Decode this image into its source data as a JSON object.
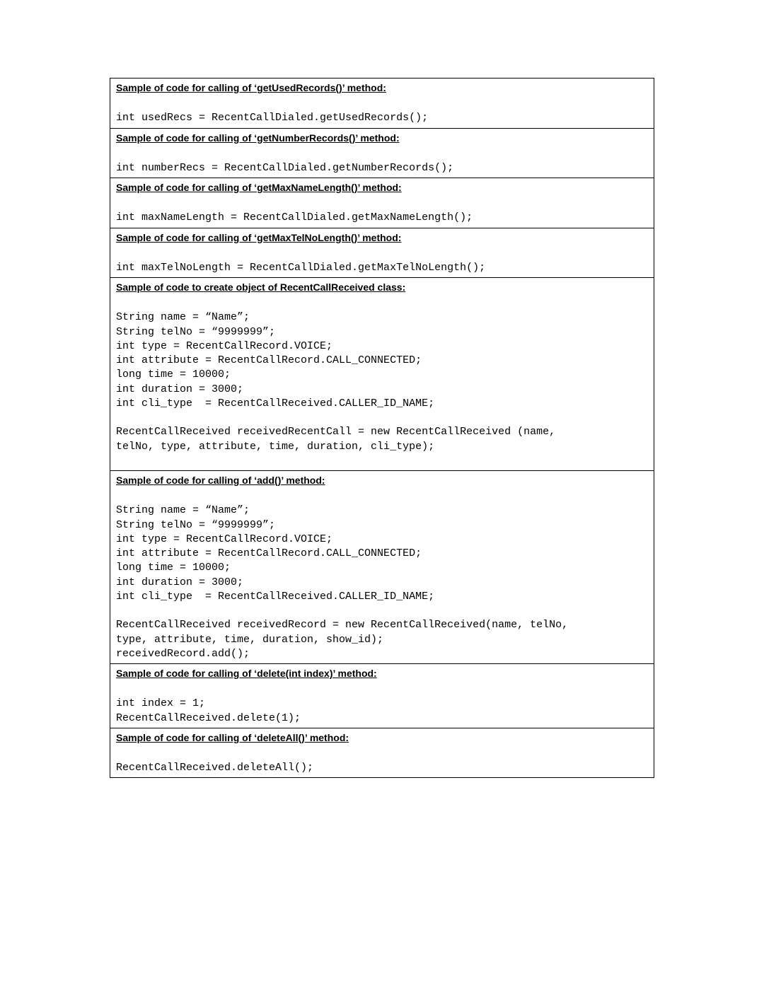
{
  "sections": [
    {
      "heading": "Sample of code for calling of ‘getUsedRecords()’ method:",
      "code": "\nint usedRecs = RecentCallDialed.getUsedRecords();\n"
    },
    {
      "heading": "Sample of code for calling of ‘getNumberRecords()’ method:",
      "code": "\nint numberRecs = RecentCallDialed.getNumberRecords();"
    },
    {
      "heading": "Sample of code for calling of ‘getMaxNameLength()’ method:",
      "code": "\nint maxNameLength = RecentCallDialed.getMaxNameLength();\n"
    },
    {
      "heading": "Sample of code for calling of ‘getMaxTelNoLength()’ method:",
      "code": "\nint maxTelNoLength = RecentCallDialed.getMaxTelNoLength();\n"
    },
    {
      "heading": "Sample of code to create object of RecentCallReceived class:",
      "code": "\nString name = “Name”;\nString telNo = “9999999”;\nint type = RecentCallRecord.VOICE;\nint attribute = RecentCallRecord.CALL_CONNECTED;\nlong time = 10000;\nint duration = 3000;\nint cli_type  = RecentCallReceived.CALLER_ID_NAME;\n\nRecentCallReceived receivedRecentCall = new RecentCallReceived (name,\ntelNo, type, attribute, time, duration, cli_type);\n\n"
    },
    {
      "heading": "Sample of code for calling of ‘add()’ method:",
      "code": "\nString name = “Name”;\nString telNo = “9999999”;\nint type = RecentCallRecord.VOICE;\nint attribute = RecentCallRecord.CALL_CONNECTED;\nlong time = 10000;\nint duration = 3000;\nint cli_type  = RecentCallReceived.CALLER_ID_NAME;\n\nRecentCallReceived receivedRecord = new RecentCallReceived(name, telNo,\ntype, attribute, time, duration, show_id);\nreceivedRecord.add();\n"
    },
    {
      "heading": "Sample of code for calling of ‘delete(int index)’ method:",
      "code": "\nint index = 1;\nRecentCallReceived.delete(1);\n"
    },
    {
      "heading": "Sample of code for calling of ‘deleteAll()’ method:",
      "code": "\nRecentCallReceived.deleteAll();"
    }
  ]
}
